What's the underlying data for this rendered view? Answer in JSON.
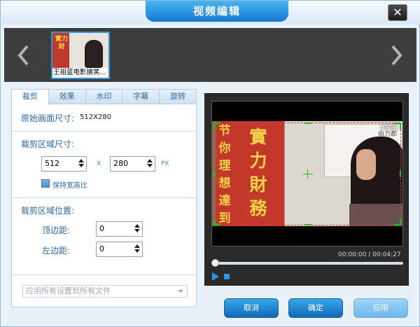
{
  "window": {
    "title": "视频编辑",
    "close_label": "✕"
  },
  "strip": {
    "thumb_caption": "王祖蓝电影搞笑...",
    "thumb_banner": "實力財"
  },
  "tabs": [
    {
      "label": "裁剪",
      "active": true
    },
    {
      "label": "效果",
      "active": false
    },
    {
      "label": "水印",
      "active": false
    },
    {
      "label": "字幕",
      "active": false
    },
    {
      "label": "旋转",
      "active": false
    }
  ],
  "crop": {
    "original_size_label": "原始画面尺寸:",
    "original_size_value": "512X280",
    "area_size_label": "裁剪区域尺寸:",
    "width": "512",
    "x_label": "X",
    "height": "280",
    "px_label": "PX",
    "keep_ratio_label": "保持宽高比",
    "area_pos_label": "裁剪区域位置:",
    "top_margin_label": "顶边距:",
    "top_margin_value": "0",
    "left_margin_label": "左边距:",
    "left_margin_value": "0"
  },
  "apply_all": {
    "label": "应用所有设置到所有文件"
  },
  "player": {
    "current_time": "00:00:00",
    "separator": "/",
    "total_time": "00:04:27",
    "progress": 0,
    "video_text_left": "节你理想達到",
    "video_text_banner": "實力財務",
    "video_text_board": "由力都",
    "video_logo": "[优酷]"
  },
  "buttons": {
    "cancel": "取消",
    "ok": "确定",
    "apply": "应用"
  },
  "colors": {
    "accent": "#2b95e8",
    "crop_border": "#d23b2f",
    "crop_handle": "#19c11c"
  }
}
